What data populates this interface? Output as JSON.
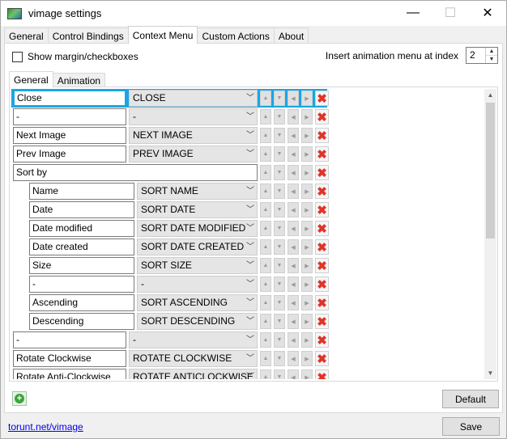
{
  "window": {
    "title": "vimage settings",
    "controls": {
      "minimize": "—",
      "maximize": "☐",
      "close": "✕"
    }
  },
  "tabs": [
    "General",
    "Control Bindings",
    "Context Menu",
    "Custom Actions",
    "About"
  ],
  "active_tab": "Context Menu",
  "options": {
    "show_margin_label": "Show margin/checkboxes",
    "insert_label": "Insert animation menu at index",
    "insert_index": "2"
  },
  "inner_tabs": [
    "General",
    "Animation"
  ],
  "rows": [
    {
      "name": "Close",
      "action": "CLOSE"
    },
    {
      "name": "-",
      "action": "-"
    },
    {
      "name": "Next Image",
      "action": "NEXT IMAGE"
    },
    {
      "name": "Prev Image",
      "action": "PREV IMAGE"
    },
    {
      "name": "Sort by",
      "action": ""
    },
    {
      "name": "Name",
      "action": "SORT NAME"
    },
    {
      "name": "Date",
      "action": "SORT DATE"
    },
    {
      "name": "Date modified",
      "action": "SORT DATE MODIFIED"
    },
    {
      "name": "Date created",
      "action": "SORT DATE CREATED"
    },
    {
      "name": "Size",
      "action": "SORT SIZE"
    },
    {
      "name": "-",
      "action": "-"
    },
    {
      "name": "Ascending",
      "action": "SORT ASCENDING"
    },
    {
      "name": "Descending",
      "action": "SORT DESCENDING"
    },
    {
      "name": "-",
      "action": "-"
    },
    {
      "name": "Rotate Clockwise",
      "action": "ROTATE CLOCKWISE"
    },
    {
      "name": "Rotate Anti-Clockwise",
      "action": "ROTATE ANTICLOCKWISE"
    }
  ],
  "row_icons": {
    "up": "▲",
    "down": "▼",
    "left": "◀",
    "right": "▶",
    "delete": "✖"
  },
  "buttons": {
    "add": "+",
    "default": "Default",
    "save": "Save"
  },
  "footer_link": "torunt.net/vimage",
  "colors": {
    "selection": "#1aa6e4",
    "delete": "#e0342a",
    "add": "#3da33d"
  }
}
